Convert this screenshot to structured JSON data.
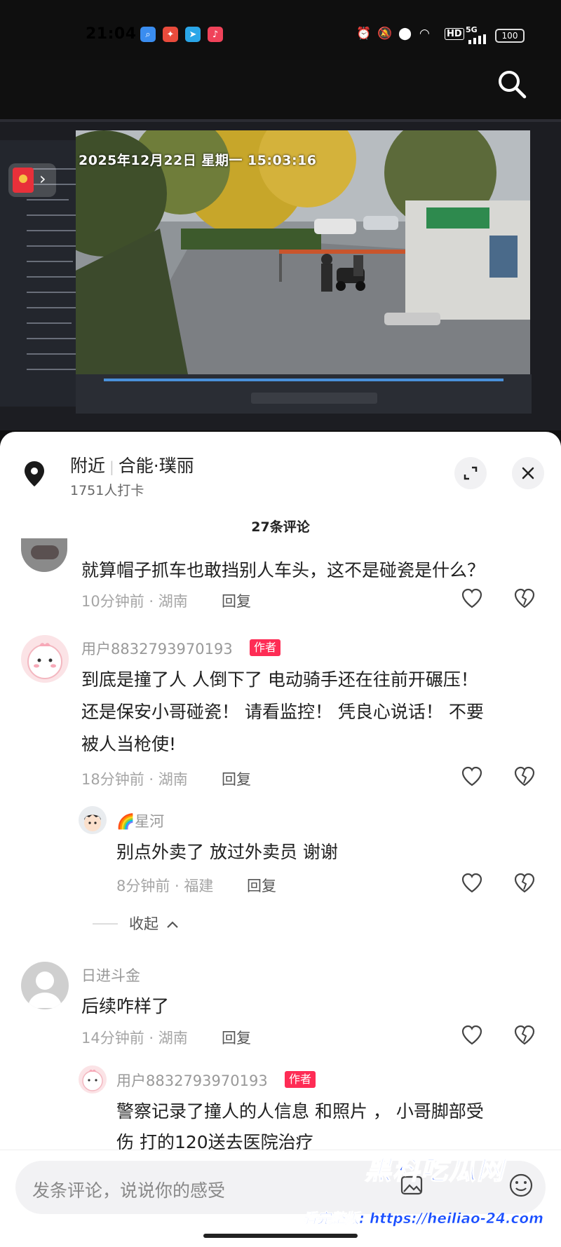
{
  "status_bar": {
    "time": "21:04",
    "battery": "100",
    "network": "5G",
    "hd": "HD"
  },
  "location": {
    "prefix": "附近",
    "name": "合能·璞丽",
    "checkins": "1751人打卡"
  },
  "video": {
    "timestamp": "2025年12月22日 星期一 15:03:16"
  },
  "comments_header": "27条评论",
  "comments": [
    {
      "text": "就算帽子抓车也敢挡别人车头，这不是碰瓷是什么？",
      "meta": "10分钟前 · 湖南",
      "reply_label": "回复"
    },
    {
      "user": "用户8832793970193",
      "badge": "作者",
      "text_lines": [
        "到底是撞了人 人倒下了 电动骑手还在往前开碾压！",
        "还是保安小哥碰瓷！ 请看监控！ 凭良心说话！ 不要",
        "被人当枪使!"
      ],
      "meta": "18分钟前 · 湖南",
      "reply_label": "回复",
      "replies": [
        {
          "user": "🌈星河",
          "text": "别点外卖了  放过外卖员  谢谢",
          "meta": "8分钟前 · 福建",
          "reply_label": "回复"
        }
      ],
      "collapse_label": "收起"
    },
    {
      "user": "日进斗金",
      "text": "后续咋样了",
      "meta": "14分钟前 · 湖南",
      "reply_label": "回复",
      "replies": [
        {
          "user": "用户8832793970193",
          "badge": "作者",
          "text_lines": [
            "警察记录了撞人的人信息 和照片 ，  小哥脚部受",
            "伤 打的120送去医院治疗"
          ]
        }
      ]
    }
  ],
  "input": {
    "placeholder": "发条评论，说说你的感受"
  },
  "watermark": {
    "brand": "黑料吃瓜网",
    "url": "看完整版: https://heiliao-24.com"
  },
  "colors": {
    "author_badge": "#fe2c55",
    "watermark": "#1a4fff"
  }
}
